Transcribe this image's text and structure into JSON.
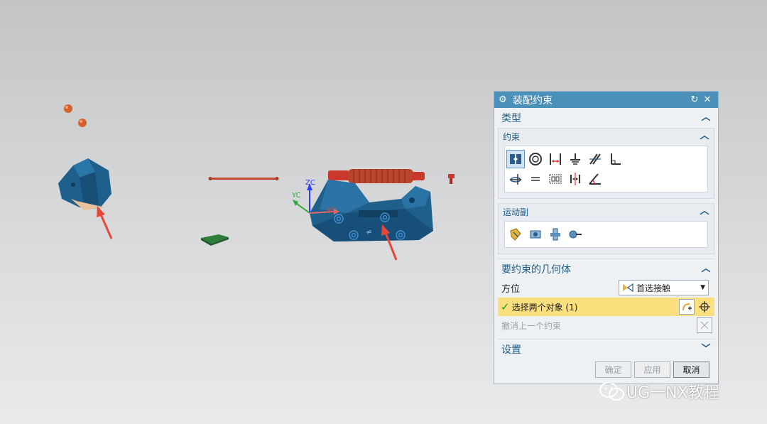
{
  "dialog": {
    "title": "装配约束",
    "sections": {
      "type": {
        "label": "类型"
      },
      "constraint": {
        "label": "约束"
      },
      "motion": {
        "label": "运动副"
      },
      "geometry": {
        "label": "要约束的几何体"
      },
      "settings": {
        "label": "设置"
      }
    },
    "orientation": {
      "label": "方位",
      "value": "首选接触"
    },
    "select_objects": {
      "label": "选择两个对象 (1)"
    },
    "undo_last": {
      "label": "撤消上一个约束"
    },
    "buttons": {
      "ok": "确定",
      "apply": "应用",
      "cancel": "取消"
    }
  },
  "triad": {
    "zc": "ZC",
    "yc": "YC",
    "xc": "XC"
  },
  "watermark": {
    "text": "UG一NX教程"
  },
  "colors": {
    "part_blue": "#1f5f8c",
    "accent_red": "#e8483a",
    "title_bar": "#4a90b8",
    "highlight_yellow": "#fbe07d"
  }
}
